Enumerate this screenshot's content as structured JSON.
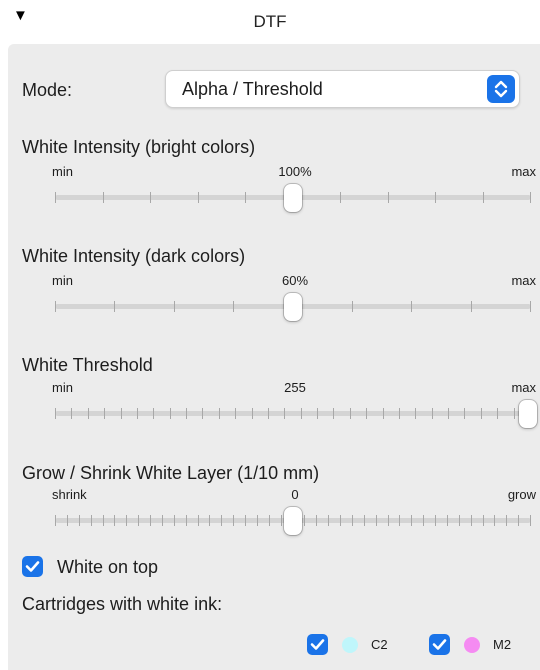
{
  "header": {
    "disclosure": "▼",
    "title": "DTF"
  },
  "mode": {
    "label": "Mode:",
    "value": "Alpha / Threshold"
  },
  "sliders": [
    {
      "label": "White Intensity (bright colors)",
      "min_label": "min",
      "max_label": "max",
      "value_label": "100%",
      "ticks": 11,
      "position": 0.5
    },
    {
      "label": "White Intensity (dark colors)",
      "min_label": "min",
      "max_label": "max",
      "value_label": "60%",
      "ticks": 9,
      "position": 0.5
    },
    {
      "label": "White Threshold",
      "min_label": "min",
      "max_label": "max",
      "value_label": "255",
      "ticks": 30,
      "position": 1.0
    },
    {
      "label": "Grow / Shrink White Layer (1/10 mm)",
      "min_label": "shrink",
      "max_label": "grow",
      "value_label": "0",
      "ticks": 41,
      "position": 0.5
    }
  ],
  "white_on_top": {
    "label": "White on top",
    "checked": true
  },
  "cartridges": {
    "label": "Cartridges with white ink:",
    "items": [
      {
        "name": "C2",
        "color": "#bff6fb",
        "checked": true
      },
      {
        "name": "M2",
        "color": "#f58bf2",
        "checked": true
      }
    ]
  },
  "colors": {
    "accent": "#1a73e8"
  }
}
